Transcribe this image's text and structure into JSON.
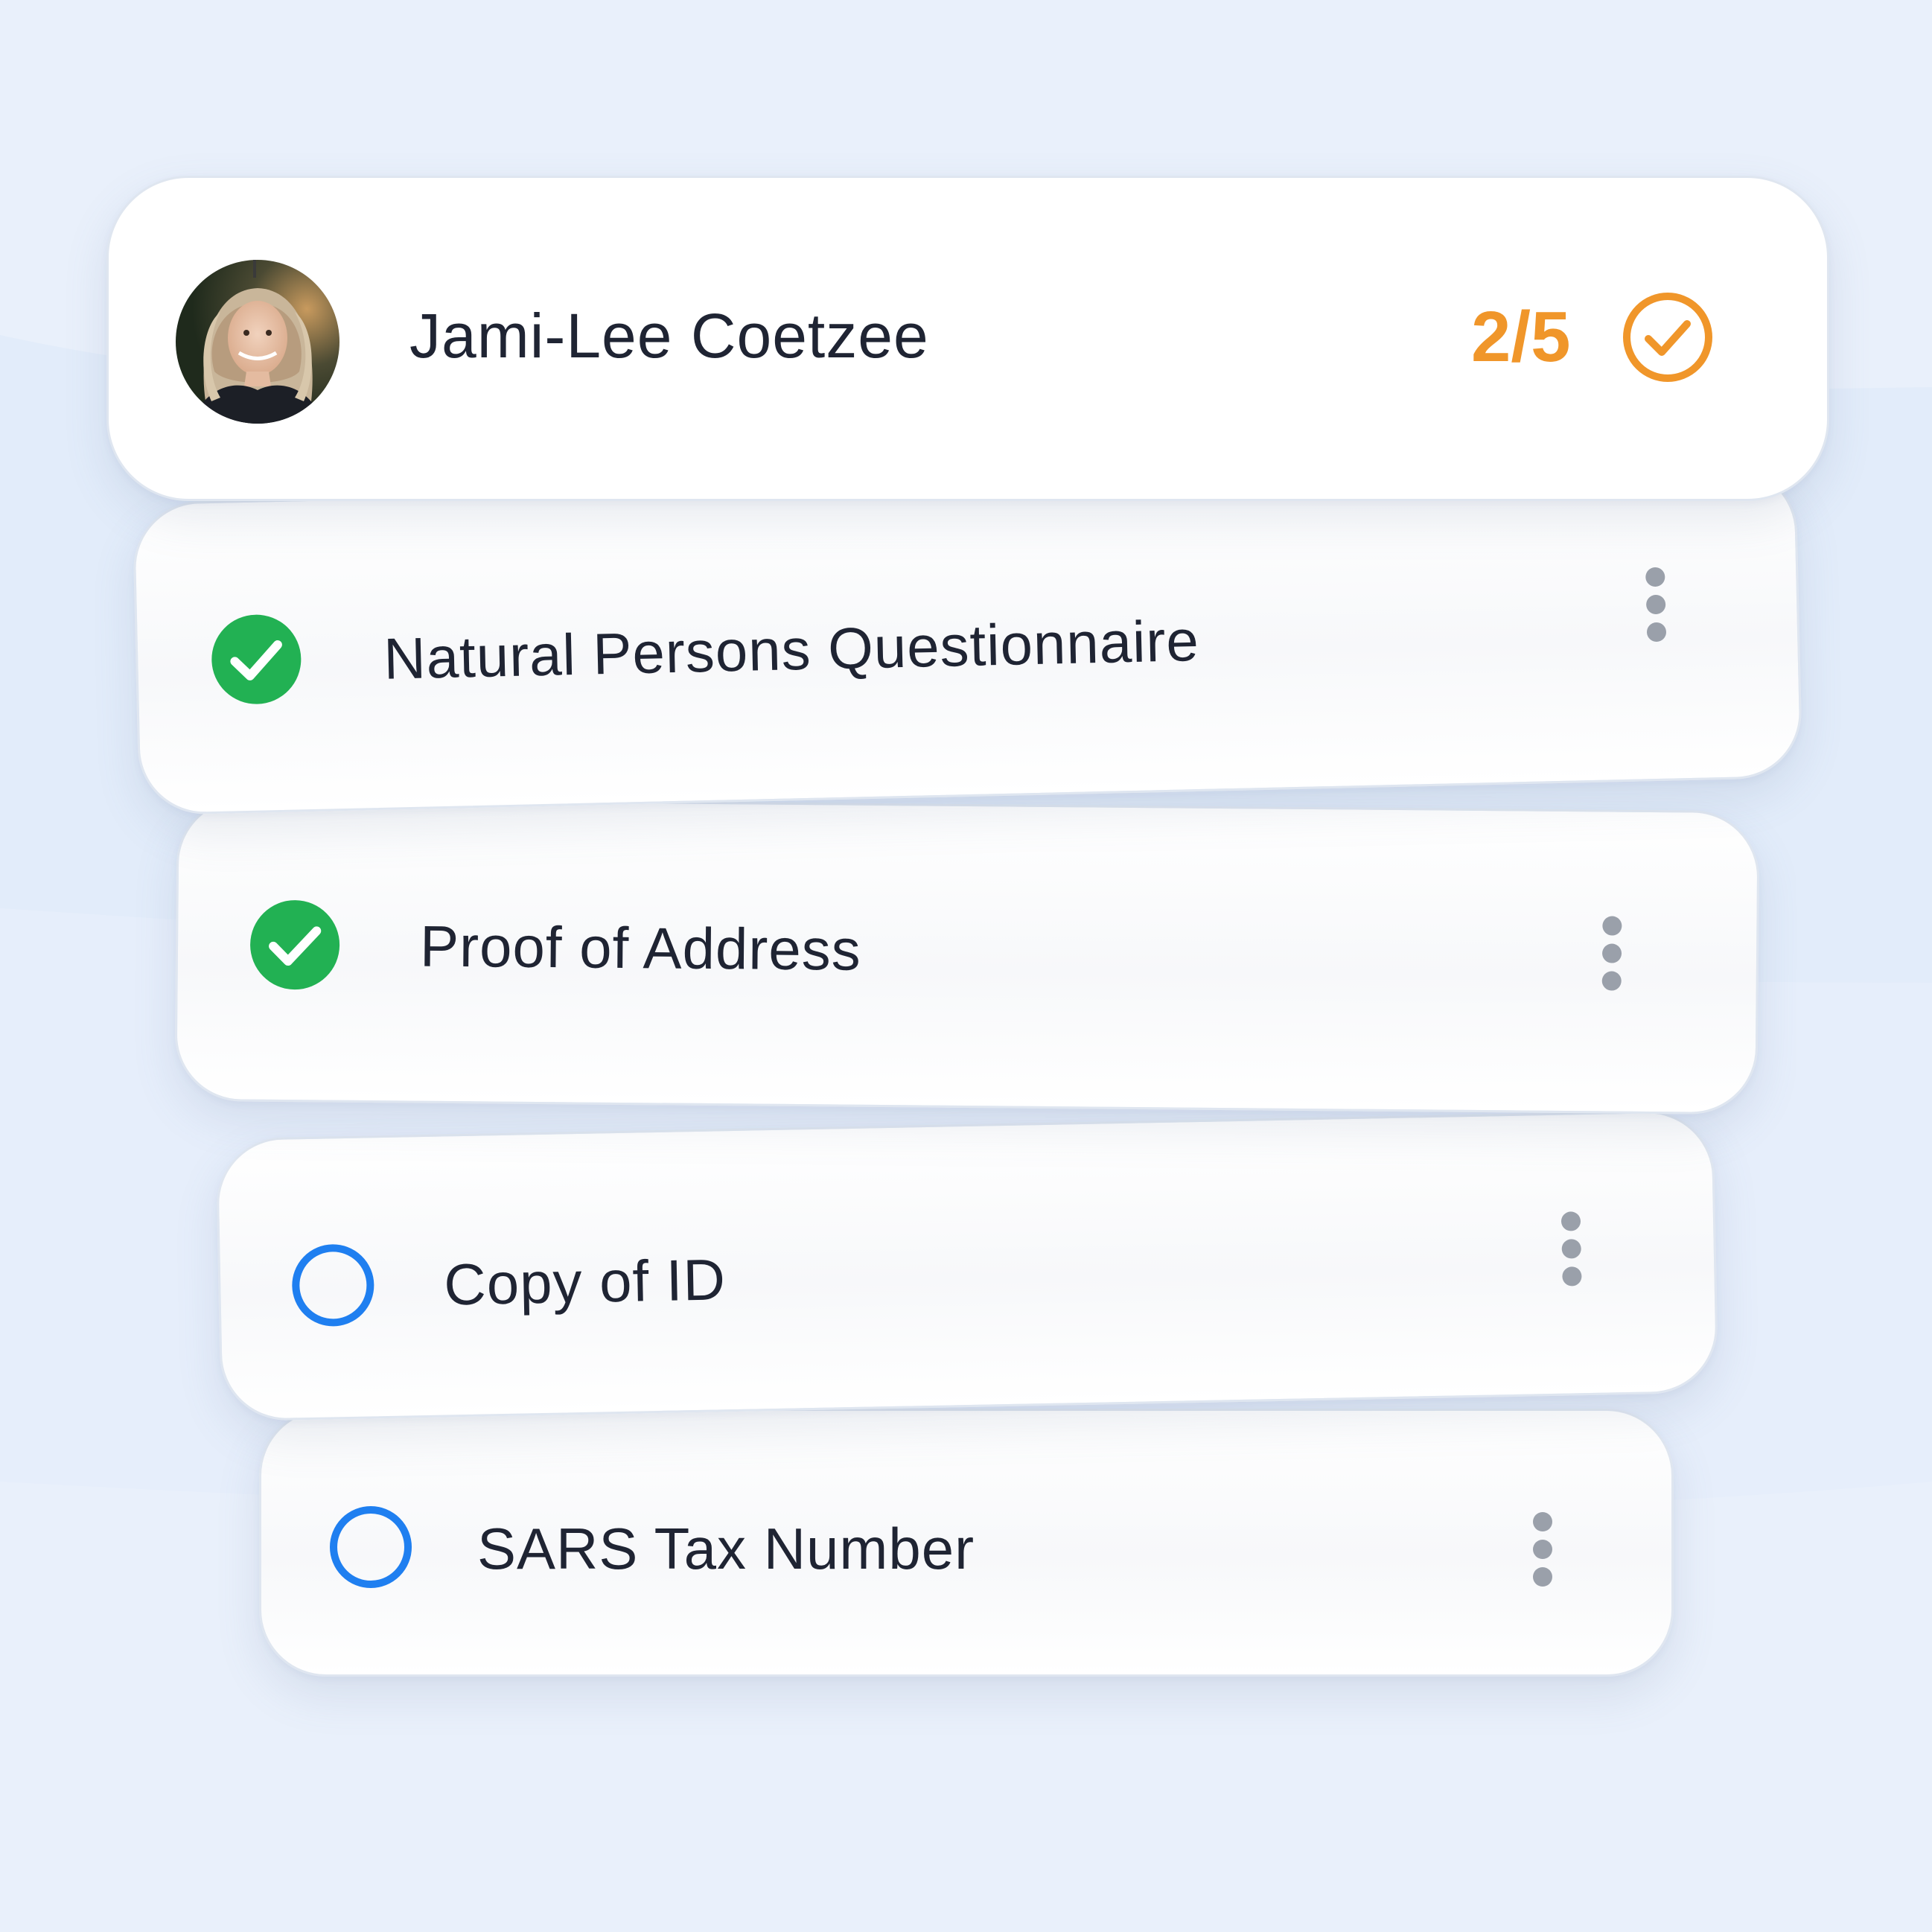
{
  "contact": {
    "name": "Jami-Lee Coetzee",
    "progress": "2/5"
  },
  "documents": [
    {
      "label": "Natural Persons Questionnaire",
      "status": "complete"
    },
    {
      "label": "Proof of Address",
      "status": "complete"
    },
    {
      "label": "Copy of ID",
      "status": "pending"
    },
    {
      "label": "SARS Tax Number",
      "status": "pending"
    }
  ],
  "colors": {
    "accent_orange": "#f0962a",
    "complete_green": "#22b153",
    "pending_blue": "#1f7ff0",
    "background": "#e9f0fb"
  },
  "icons": {
    "progress": "circle-check-outline-icon",
    "complete": "check-circle-filled-icon",
    "pending": "empty-circle-icon",
    "menu": "more-vertical-icon"
  }
}
